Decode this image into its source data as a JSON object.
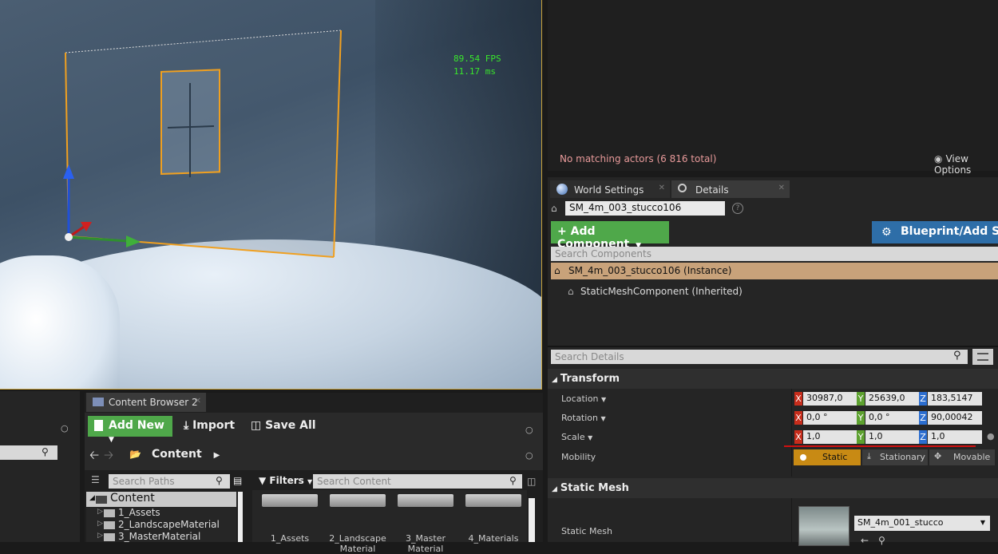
{
  "viewport": {
    "fps": "89.54 FPS",
    "ms": "11.17 ms"
  },
  "outliner": {
    "status": "No matching actors (6 816 total)",
    "view_options": "View Options"
  },
  "details": {
    "tabs": [
      {
        "label": "World Settings",
        "icon": "globe-icon"
      },
      {
        "label": "Details",
        "icon": "magnifier-icon"
      }
    ],
    "actor_name": "SM_4m_003_stucco106",
    "add_component": "+ Add Component",
    "blueprint": "Blueprint/Add Script",
    "search_components_placeholder": "Search Components",
    "instance_label": "SM_4m_003_stucco106 (Instance)",
    "inherited_label": "StaticMeshComponent (Inherited)",
    "search_details_placeholder": "Search Details",
    "transform": {
      "title": "Transform",
      "location_label": "Location",
      "location": {
        "x": "30987,0",
        "y": "25639,0",
        "z": "183,5147"
      },
      "rotation_label": "Rotation",
      "rotation": {
        "x": "0,0 °",
        "y": "0,0 °",
        "z": "90,00042"
      },
      "scale_label": "Scale",
      "scale": {
        "x": "1,0",
        "y": "1,0",
        "z": "1,0"
      },
      "mobility_label": "Mobility",
      "mobility": {
        "static": "Static",
        "stationary": "Stationary",
        "movable": "Movable"
      }
    },
    "static_mesh": {
      "title": "Static Mesh",
      "label": "Static Mesh",
      "value": "SM_4m_001_stucco"
    },
    "axis": {
      "x": "X",
      "y": "Y",
      "z": "Z"
    }
  },
  "content_browser": {
    "tab": "Content Browser 2",
    "add_new": "Add New",
    "import": "Import",
    "save_all": "Save All",
    "path": "Content",
    "filters": "Filters",
    "search_paths_placeholder": "Search Paths",
    "search_content_placeholder": "Search Content",
    "tree": [
      {
        "label": "Content",
        "selected": true
      },
      {
        "label": "1_Assets"
      },
      {
        "label": "2_LandscapeMaterial"
      },
      {
        "label": "3_MasterMaterial"
      }
    ],
    "tiles": [
      "1_Assets",
      "2_Landscape Material",
      "3_Master Material",
      "4_Materials"
    ]
  },
  "colors": {
    "accent_green": "#4fa84a",
    "accent_blue": "#2e6ea8",
    "selection_orange": "#f0a020",
    "fps_green": "#39e62c",
    "warning_red": "#e89a9a"
  }
}
